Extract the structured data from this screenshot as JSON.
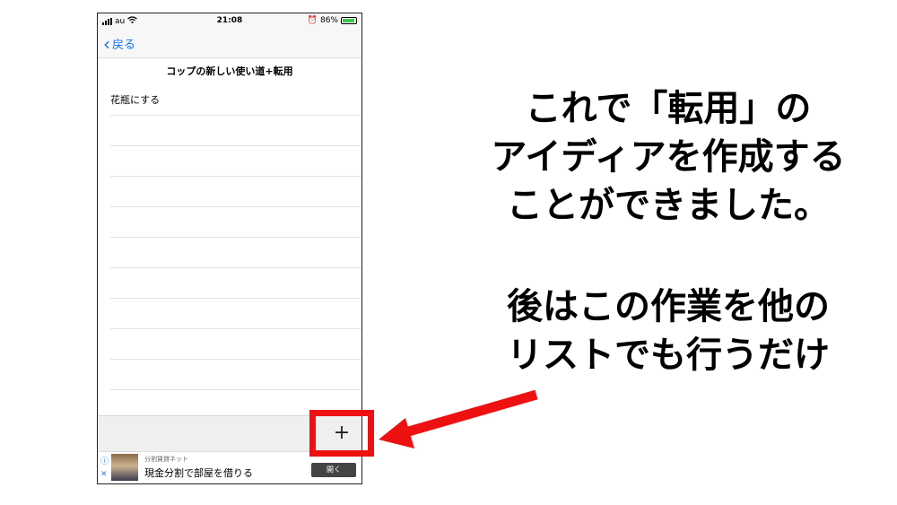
{
  "status_bar": {
    "carrier": "au",
    "time": "21:08",
    "battery": "86%"
  },
  "nav": {
    "back_label": "戻る"
  },
  "list": {
    "title": "コップの新しい使い道+転用",
    "items": [
      "花瓶にする",
      "",
      "",
      "",
      "",
      "",
      "",
      "",
      "",
      "",
      ""
    ]
  },
  "toolbar": {
    "add_label": "+"
  },
  "ad": {
    "source": "分割賃貸ネット",
    "headline": "現金分割で部屋を借りる",
    "button": "開く",
    "info_icon": "ⓘ",
    "close_icon": "✕"
  },
  "annotation": {
    "caption1": [
      "これで「転用」の",
      "アイディアを作成する",
      "ことができました。"
    ],
    "caption2": [
      "後はこの作業を他の",
      "リストでも行うだけ"
    ],
    "highlight_color": "#ee1111"
  }
}
